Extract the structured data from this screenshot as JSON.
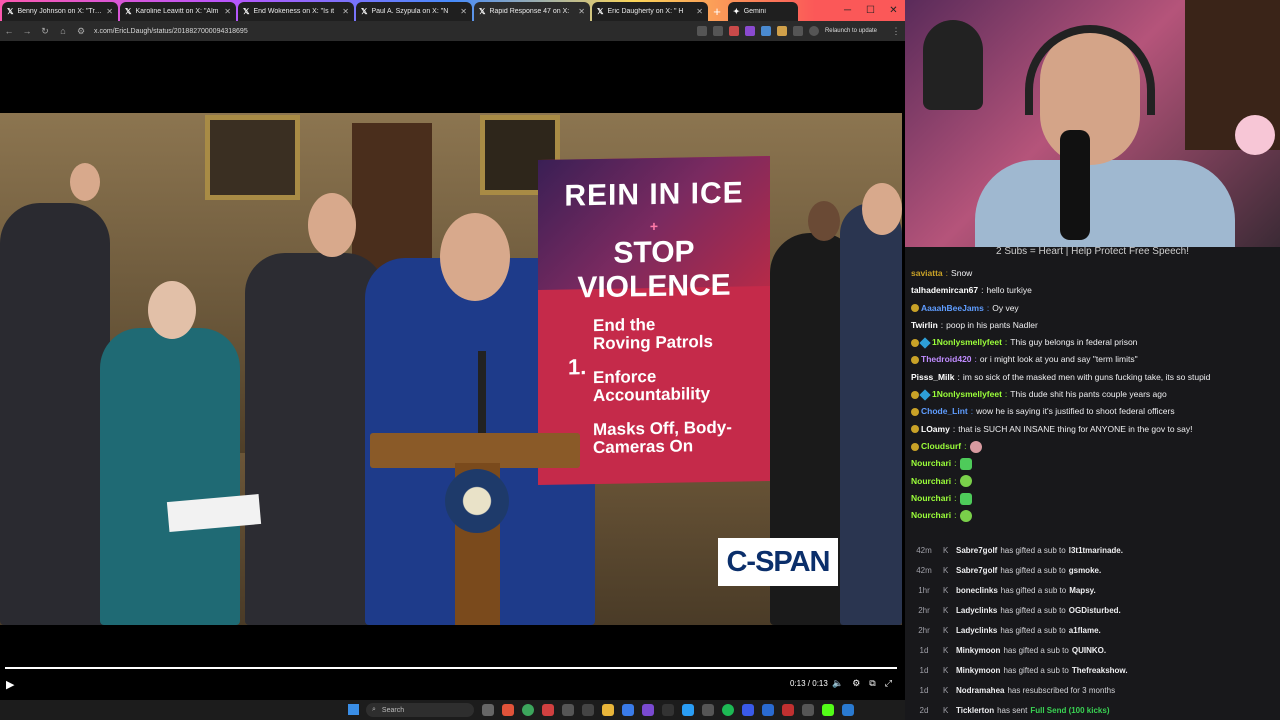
{
  "browser": {
    "tabs": [
      {
        "label": "Benny Johnson on X: \"Trum"
      },
      {
        "label": "Karoline Leavitt on X: \"Alm"
      },
      {
        "label": "End Wokeness on X: \"Is it"
      },
      {
        "label": "Paul A. Szypula on X: \"N"
      },
      {
        "label": "Rapid Response 47 on X:"
      },
      {
        "label": "Eric Daugherty on X: \" H"
      },
      {
        "label": "Gemini"
      }
    ],
    "url": "x.com/EricLDaugh/status/2018827000094318695",
    "relaunch_label": "Relaunch to update"
  },
  "video": {
    "sign": {
      "line1": "REIN IN ICE",
      "plus": "+",
      "line2": "STOP VIOLENCE",
      "number": "1.",
      "item1": "End the Roving Patrols",
      "item2": "Enforce Accountability",
      "item3": "Masks Off, Body-Cameras On"
    },
    "network_logo": "C-SPAN",
    "time": "0:13 / 0:13",
    "progress": 1.0
  },
  "taskbar": {
    "search_placeholder": "Search"
  },
  "chat": {
    "banner": "2 Subs = Heart | Help Protect Free Speech!",
    "messages": [
      {
        "user": "saviatta",
        "text": "Snow",
        "color": "#c9a227"
      },
      {
        "user": "talhademircan67",
        "text": "hello turkiye",
        "color": "#ffffff"
      },
      {
        "user": "AaaahBeeJams",
        "text": "Oy vey",
        "color": "#5f9dff"
      },
      {
        "user": "Twirlin",
        "text": "poop in his pants Nadler",
        "color": "#ffffff"
      },
      {
        "user": "1Nonlysmellyfeet",
        "text": "This guy belongs in federal prison",
        "color": "#9bff3a"
      },
      {
        "user": "Thedroid420",
        "text": "or i might look at you and say \"term limits\"",
        "color": "#c08cff"
      },
      {
        "user": "Pisss_Milk",
        "text": "im so sick of the masked men with guns fucking take, its so stupid",
        "color": "#ffffff"
      },
      {
        "user": "1Nonlysmellyfeet",
        "text": "This dude shit his pants couple years ago",
        "color": "#9bff3a"
      },
      {
        "user": "Chode_Lint",
        "text": "wow he is saying it's justified to shoot federal officers",
        "color": "#5f9dff"
      },
      {
        "user": "LOamy",
        "text": "that is SUCH AN INSANE thing for ANYONE in the gov to say!",
        "color": "#ffffff"
      },
      {
        "user": "Cloudsurf",
        "text": "",
        "color": "#9bff3a"
      },
      {
        "user": "Nourchari",
        "text": "",
        "color": "#9bff3a"
      },
      {
        "user": "Nourchari",
        "text": "",
        "color": "#9bff3a"
      },
      {
        "user": "Nourchari",
        "text": "",
        "color": "#9bff3a"
      },
      {
        "user": "Nourchari",
        "text": "",
        "color": "#9bff3a"
      }
    ],
    "subs": [
      {
        "time": "42m",
        "user": "Sabre7golf",
        "action": "has gifted a sub to",
        "target": "l3t1tmarinade."
      },
      {
        "time": "42m",
        "user": "Sabre7golf",
        "action": "has gifted a sub to",
        "target": "gsmoke."
      },
      {
        "time": "1hr",
        "user": "boneclinks",
        "action": "has gifted a sub to",
        "target": "Mapsy."
      },
      {
        "time": "2hr",
        "user": "Ladyclinks",
        "action": "has gifted a sub to",
        "target": "OGDisturbed."
      },
      {
        "time": "2hr",
        "user": "Ladyclinks",
        "action": "has gifted a sub to",
        "target": "a1flame."
      },
      {
        "time": "1d",
        "user": "Minkymoon",
        "action": "has gifted a sub to",
        "target": "QUINKO."
      },
      {
        "time": "1d",
        "user": "Minkymoon",
        "action": "has gifted a sub to",
        "target": "Thefreakshow."
      },
      {
        "time": "1d",
        "user": "Nodramahea",
        "action": "has resubscribed for 3 months",
        "target": ""
      },
      {
        "time": "2d",
        "user": "Ticklerton",
        "action": "has sent",
        "target": "Full Send (100 kicks)"
      }
    ]
  },
  "colors": {
    "chat_bg": "#18181b",
    "sign_red": "#c52a4a",
    "cspan_blue": "#0b2f6b"
  }
}
